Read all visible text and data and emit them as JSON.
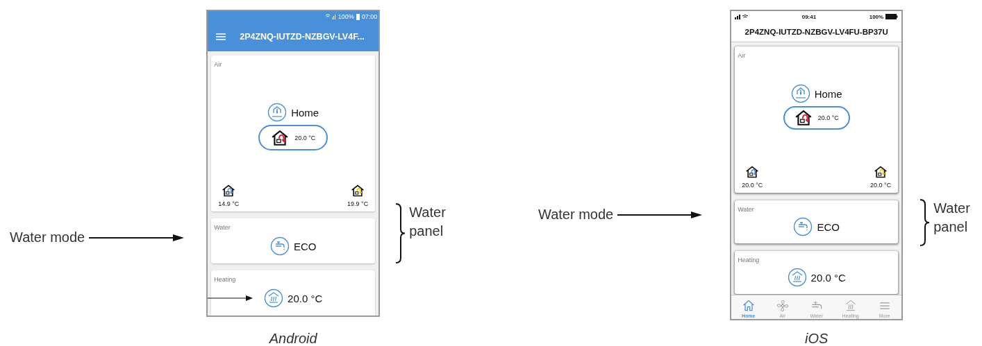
{
  "figures": [
    {
      "kind": "android",
      "caption": "Android",
      "annotation": "Water mode",
      "side_label": "Water panel",
      "status": {
        "battery": "100%",
        "time": "07:00"
      },
      "title": "2P4ZNQ-IUTZD-NZBGV-LV4F...",
      "panels": [
        {
          "kind": "air",
          "label": "Air",
          "mode": "Home",
          "setpoint": "20.0 °C",
          "left_temp": "14.9 °C",
          "right_temp": "19.9 °C"
        },
        {
          "kind": "water",
          "label": "Water",
          "value": "ECO"
        },
        {
          "kind": "heating",
          "label": "Heating",
          "value": "20.0 °C",
          "arrow": true
        }
      ]
    },
    {
      "kind": "ios",
      "caption": "iOS",
      "annotation": "Water mode",
      "side_label": "Water panel",
      "status": {
        "time": "09:41",
        "battery": "100%"
      },
      "title": "2P4ZNQ-IUTZD-NZBGV-LV4FU-BP37U",
      "panels": [
        {
          "kind": "air",
          "label": "Air",
          "mode": "Home",
          "setpoint": "20.0 °C",
          "left_temp": "20.0 °C",
          "right_temp": "20.0 °C"
        },
        {
          "kind": "water",
          "label": "Water",
          "value": "ECO"
        },
        {
          "kind": "heating",
          "label": "Heating",
          "value": "20.0 °C"
        }
      ],
      "tabs": [
        {
          "kind": "home",
          "label": "Home",
          "selected": true
        },
        {
          "kind": "air",
          "label": "Air",
          "selected": false
        },
        {
          "kind": "water",
          "label": "Water",
          "selected": false
        },
        {
          "kind": "heating",
          "label": "Heating",
          "selected": false
        },
        {
          "kind": "more",
          "label": "More",
          "selected": false
        }
      ]
    }
  ]
}
